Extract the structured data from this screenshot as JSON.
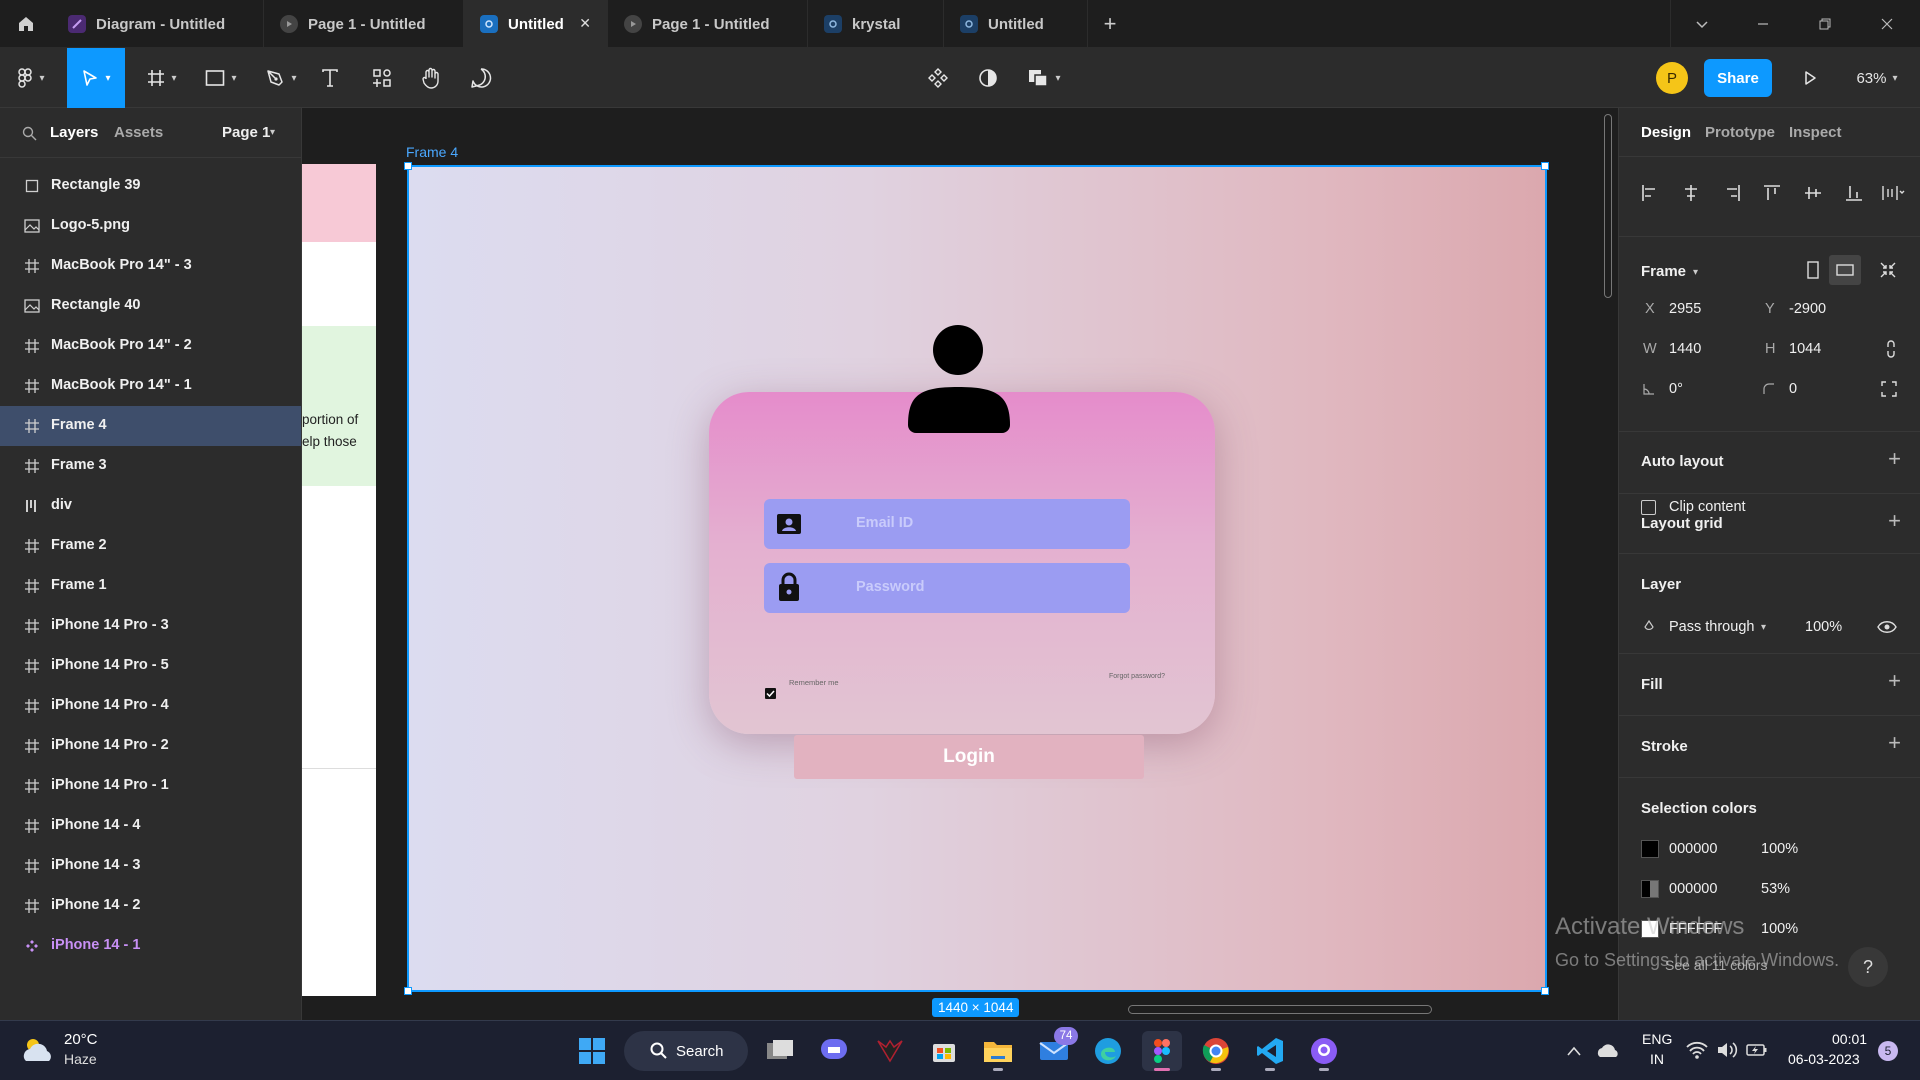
{
  "tabs": [
    {
      "label": "Diagram - Untitled"
    },
    {
      "label": "Page 1 - Untitled"
    },
    {
      "label": "Untitled",
      "active": true
    },
    {
      "label": "Page 1 - Untitled"
    },
    {
      "label": "krystal"
    },
    {
      "label": "Untitled"
    }
  ],
  "toolbar": {
    "share_label": "Share",
    "zoom": "63%",
    "avatar_initial": "P"
  },
  "left_panel": {
    "tab_layers": "Layers",
    "tab_assets": "Assets",
    "page_selector": "Page 1",
    "layers": [
      {
        "name": "Rectangle 39",
        "icon": "rectangle-icon"
      },
      {
        "name": "Logo-5.png",
        "icon": "image-icon"
      },
      {
        "name": "MacBook Pro 14\" - 3",
        "icon": "frame-icon"
      },
      {
        "name": "Rectangle 40",
        "icon": "image-icon"
      },
      {
        "name": "MacBook Pro 14\" - 2",
        "icon": "frame-icon"
      },
      {
        "name": "MacBook Pro 14\" - 1",
        "icon": "frame-icon"
      },
      {
        "name": "Frame 4",
        "icon": "frame-icon",
        "selected": true
      },
      {
        "name": "Frame 3",
        "icon": "frame-icon"
      },
      {
        "name": "div",
        "icon": "autolayout-icon"
      },
      {
        "name": "Frame 2",
        "icon": "frame-icon"
      },
      {
        "name": "Frame 1",
        "icon": "frame-icon"
      },
      {
        "name": "iPhone 14 Pro - 3",
        "icon": "frame-icon"
      },
      {
        "name": "iPhone 14 Pro - 5",
        "icon": "frame-icon"
      },
      {
        "name": "iPhone 14 Pro - 4",
        "icon": "frame-icon"
      },
      {
        "name": "iPhone 14 Pro - 2",
        "icon": "frame-icon"
      },
      {
        "name": "iPhone 14 Pro - 1",
        "icon": "frame-icon"
      },
      {
        "name": "iPhone 14 - 4",
        "icon": "frame-icon"
      },
      {
        "name": "iPhone 14 - 3",
        "icon": "frame-icon"
      },
      {
        "name": "iPhone 14 - 2",
        "icon": "frame-icon"
      },
      {
        "name": "iPhone 14 - 1",
        "icon": "component-icon"
      }
    ]
  },
  "canvas": {
    "frame_label": "Frame 4",
    "size_badge": "1440 × 1044",
    "partial_text_1": "portion of",
    "partial_text_2": "elp those",
    "login": {
      "email_placeholder": "Email ID",
      "password_placeholder": "Password",
      "remember_label": "Remember me",
      "forgot_label": "Forgot password?",
      "login_button": "Login"
    }
  },
  "right_panel": {
    "tabs": [
      "Design",
      "Prototype",
      "Inspect"
    ],
    "frame_label": "Frame",
    "x_label": "X",
    "x_value": "2955",
    "y_label": "Y",
    "y_value": "-2900",
    "w_label": "W",
    "w_value": "1440",
    "h_label": "H",
    "h_value": "1044",
    "rotation": "0°",
    "radius": "0",
    "clip_content": "Clip content",
    "auto_layout": "Auto layout",
    "layout_grid": "Layout grid",
    "layer": "Layer",
    "blend_mode": "Pass through",
    "opacity": "100%",
    "fill": "Fill",
    "stroke": "Stroke",
    "selection_colors": "Selection colors",
    "colors": [
      {
        "hex": "000000",
        "opacity": "100%",
        "swatch": "#000000"
      },
      {
        "hex": "000000",
        "opacity": "53%",
        "swatch": "#000000"
      },
      {
        "hex": "FFFFFF",
        "opacity": "100%",
        "swatch": "#FFFFFF"
      }
    ],
    "see_all": "See all 11 colors",
    "watermark_title": "Activate Windows",
    "watermark_sub": "Go to Settings to activate Windows."
  },
  "taskbar": {
    "temp": "20°C",
    "weather": "Haze",
    "search": "Search",
    "mail_badge": "74",
    "lang_1": "ENG",
    "lang_2": "IN",
    "time": "00:01",
    "date": "06-03-2023",
    "notif_count": "5"
  },
  "colors": {
    "accent": "#0d99ff",
    "selection": "#3e4e6b",
    "component": "#c890f5"
  }
}
